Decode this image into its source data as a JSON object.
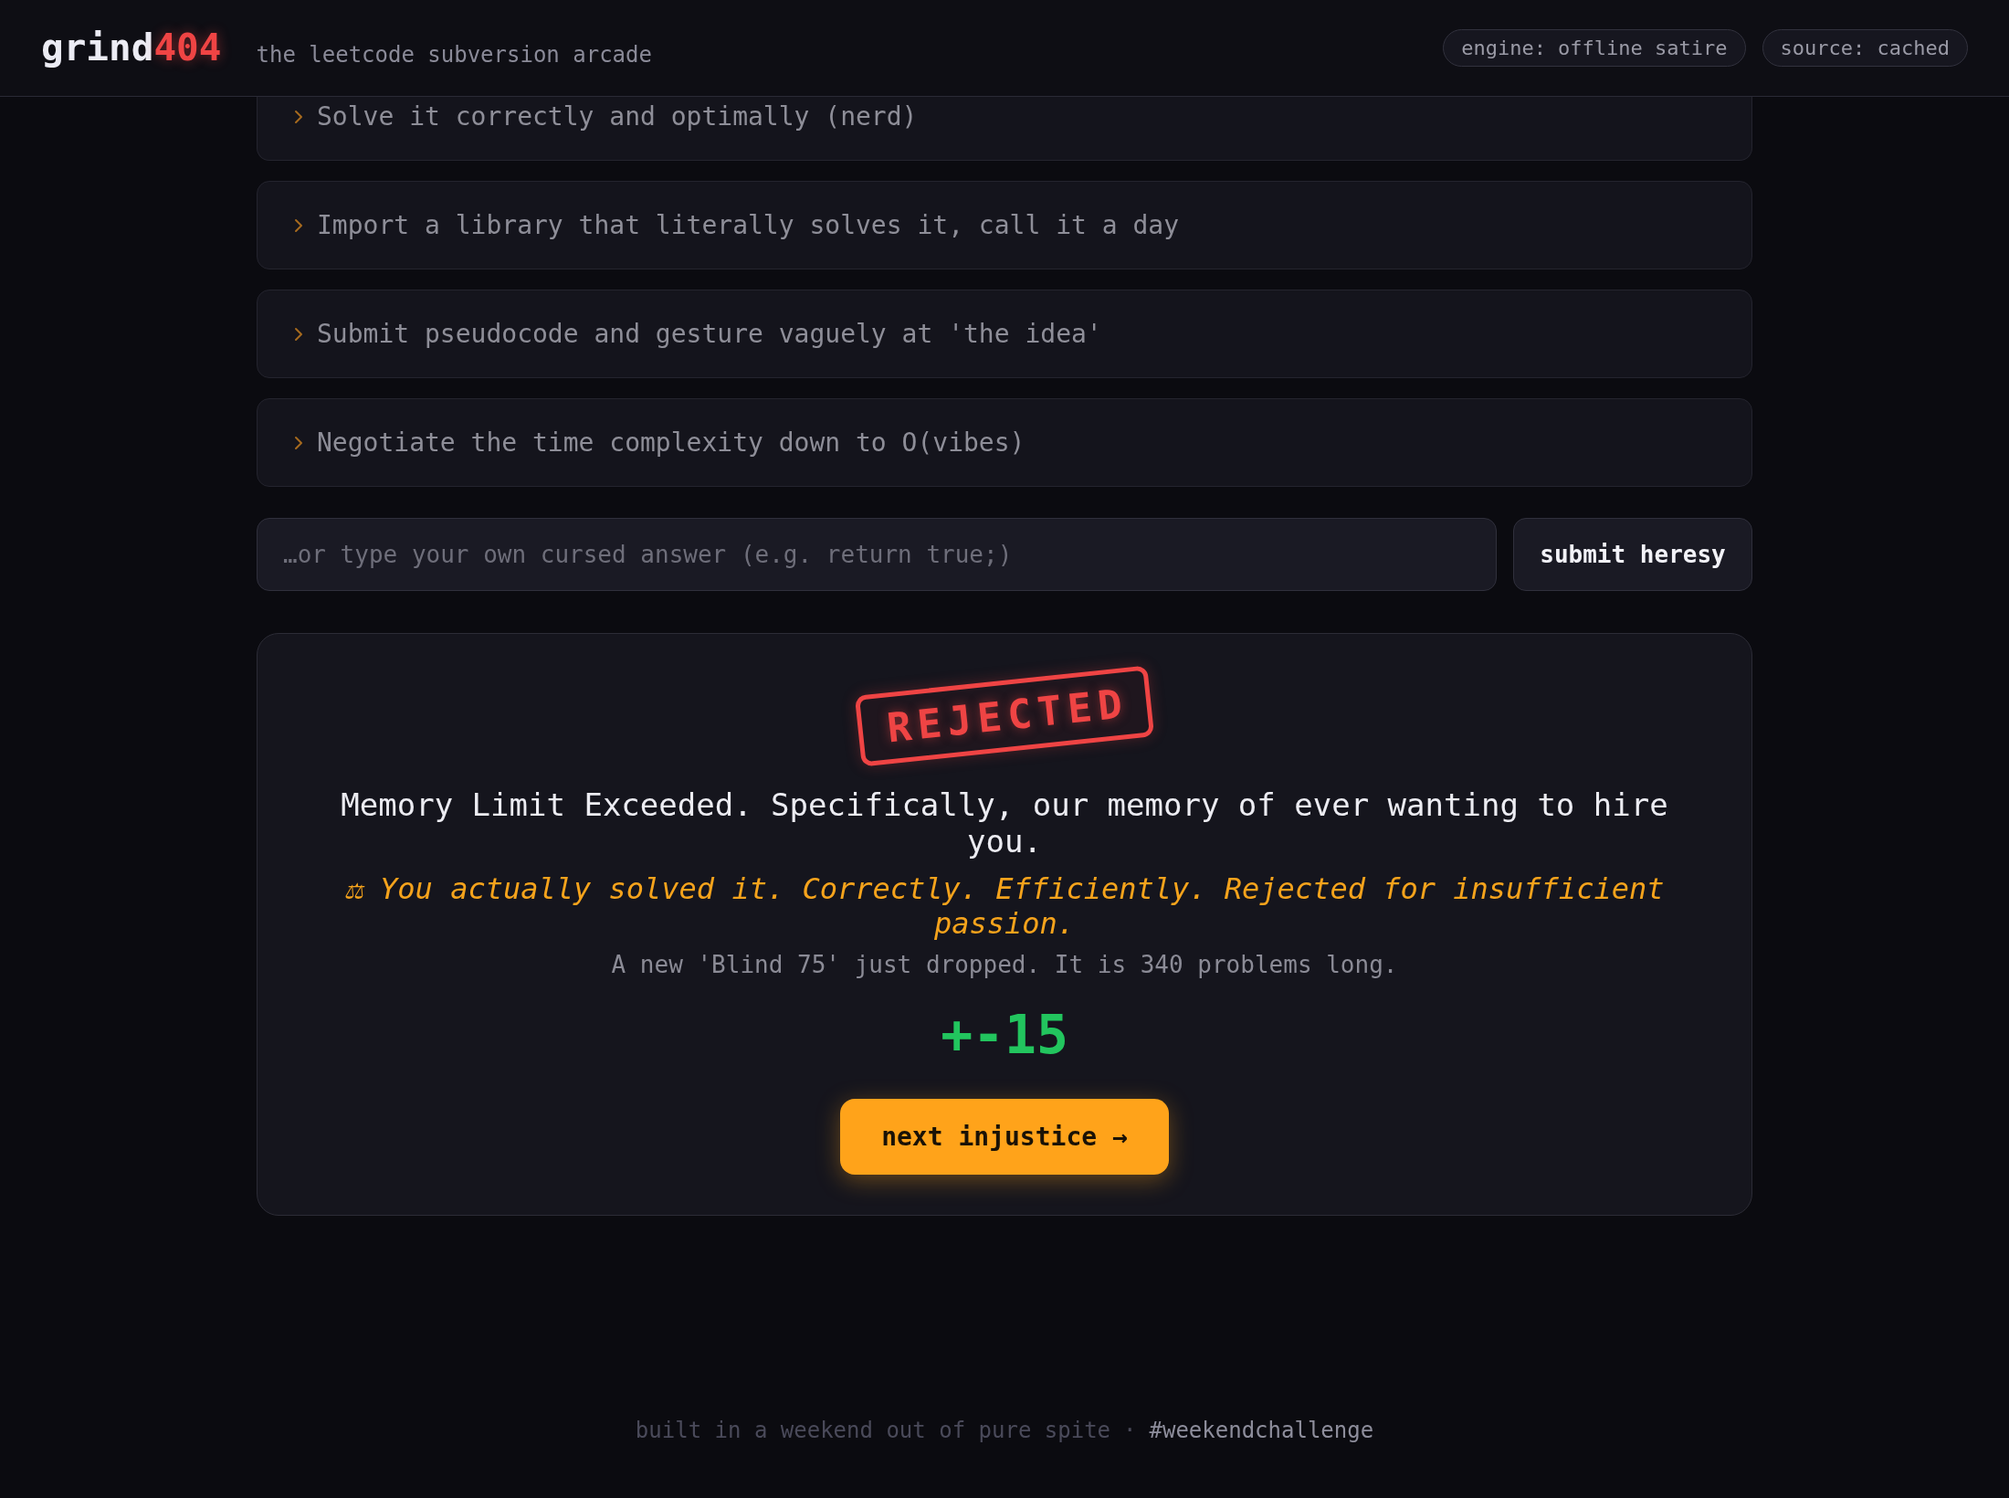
{
  "header": {
    "logo": {
      "name": "grind",
      "accent": "404"
    },
    "tagline": "the leetcode subversion arcade",
    "chips": [
      "engine: offline satire",
      "source: cached"
    ]
  },
  "options": [
    "Solve it correctly and optimally (nerd)",
    "Import a library that literally solves it, call it a day",
    "Submit pseudocode and gesture vaguely at 'the idea'",
    "Negotiate the time complexity down to O(vibes)"
  ],
  "answer": {
    "placeholder": "…or type your own cursed answer (e.g. return true;)",
    "button": "submit heresy"
  },
  "result": {
    "stamp": "REJECTED",
    "verdict": "Memory Limit Exceeded. Specifically, our memory of ever wanting to hire you.",
    "note": "⚖ You actually solved it. Correctly. Efficiently. Rejected for insufficient passion.",
    "aside": "A new 'Blind 75' just dropped. It is 340 problems long.",
    "score": "+-15",
    "button": "next injustice →"
  },
  "footer": {
    "credit": "built in a weekend out of pure spite",
    "separator": "·",
    "tag": "#weekendchallenge"
  }
}
